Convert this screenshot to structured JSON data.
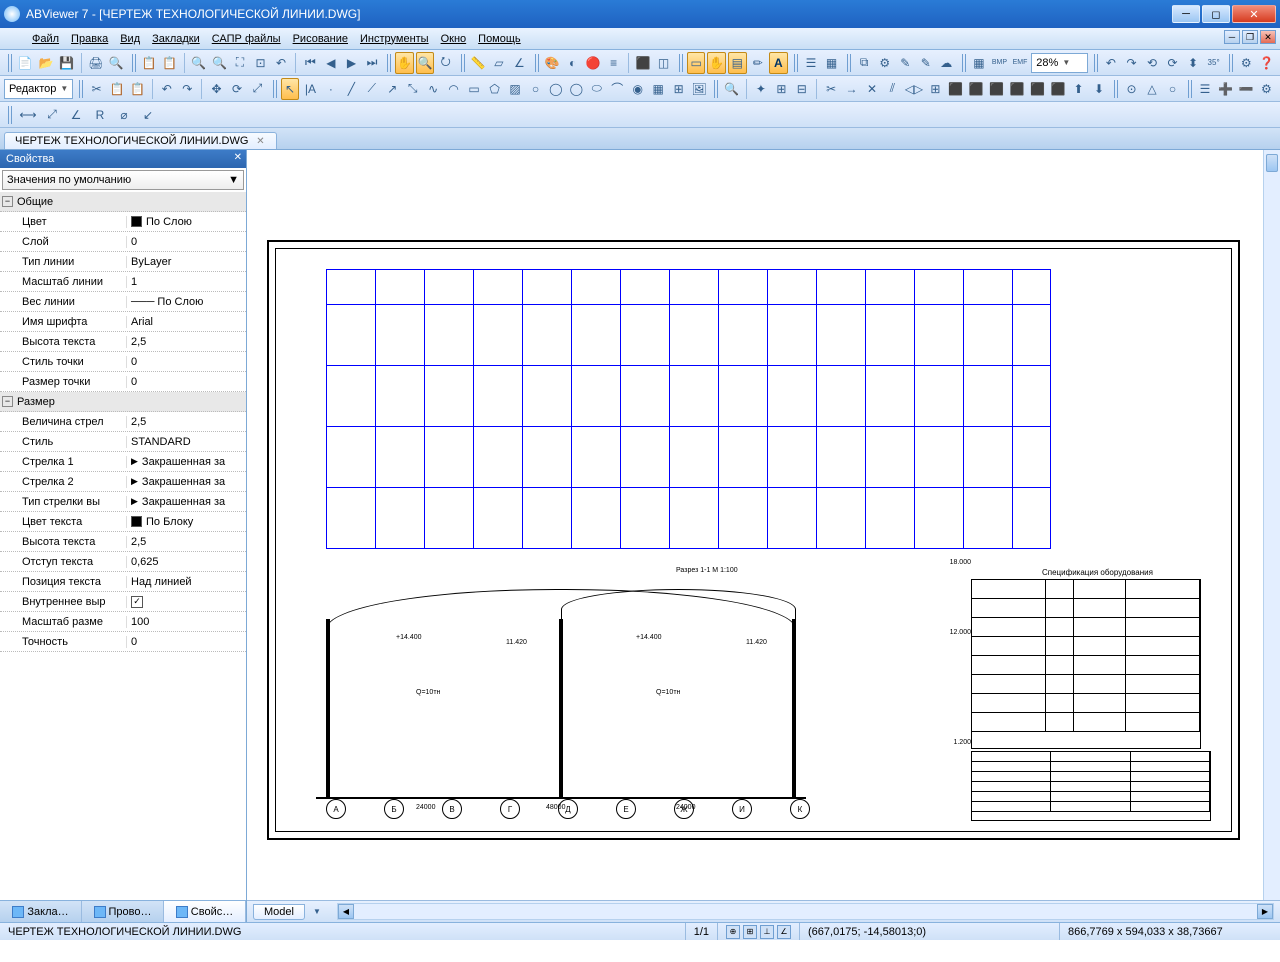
{
  "window": {
    "title": "ABViewer 7 - [ЧЕРТЕЖ ТЕХНОЛОГИЧЕСКОЙ ЛИНИИ.DWG]"
  },
  "menu": {
    "file": "Файл",
    "edit": "Правка",
    "view": "Вид",
    "bookmarks": "Закладки",
    "cad_files": "САПР файлы",
    "drawing": "Рисование",
    "tools": "Инструменты",
    "window": "Окно",
    "help": "Помощь"
  },
  "toolbar": {
    "mode_selector": "Редактор",
    "zoom_value": "28%"
  },
  "document_tab": {
    "name": "ЧЕРТЕЖ ТЕХНОЛОГИЧЕСКОЙ ЛИНИИ.DWG"
  },
  "properties_panel": {
    "title": "Свойства",
    "defaults_selector": "Значения по умолчанию",
    "categories": {
      "general": "Общие",
      "dimension": "Размер"
    },
    "rows": [
      {
        "k": "Цвет",
        "v": "По Слою",
        "swatch": true
      },
      {
        "k": "Слой",
        "v": "0"
      },
      {
        "k": "Тип линии",
        "v": "ByLayer"
      },
      {
        "k": "Масштаб линии",
        "v": "1"
      },
      {
        "k": "Вес линии",
        "v": "─── По Слою"
      },
      {
        "k": "Имя шрифта",
        "v": "Arial"
      },
      {
        "k": "Высота текста",
        "v": "2,5"
      },
      {
        "k": "Стиль точки",
        "v": "0"
      },
      {
        "k": "Размер точки",
        "v": "0"
      }
    ],
    "dim_rows": [
      {
        "k": "Величина стрел",
        "v": "2,5"
      },
      {
        "k": "Стиль",
        "v": "STANDARD"
      },
      {
        "k": "Стрелка 1",
        "v": "Закрашенная за",
        "arrow": true
      },
      {
        "k": "Стрелка 2",
        "v": "Закрашенная за",
        "arrow": true
      },
      {
        "k": "Тип стрелки вы",
        "v": "Закрашенная за",
        "arrow": true
      },
      {
        "k": "Цвет текста",
        "v": "По Блоку",
        "swatch": true
      },
      {
        "k": "Высота текста",
        "v": "2,5"
      },
      {
        "k": "Отступ текста",
        "v": "0,625"
      },
      {
        "k": "Позиция текста",
        "v": "Над линией"
      },
      {
        "k": "Внутреннее выр",
        "v": "",
        "check": true
      },
      {
        "k": "Масштаб разме",
        "v": "100"
      },
      {
        "k": "Точность",
        "v": "0"
      }
    ]
  },
  "bottom_tabs": {
    "bookmarks": "Закла…",
    "explorer": "Прово…",
    "properties": "Свойс…"
  },
  "canvas_tabs": {
    "model": "Model"
  },
  "drawing_labels": {
    "section_title": "Разрез 1-1 М 1:100",
    "spec_title": "Спецификация оборудования",
    "dim1": "+14.400",
    "dim2": "11.420",
    "load": "Q=10тн",
    "span1": "24000",
    "span2": "48000",
    "lvl1": "18.000",
    "lvl2": "12.000",
    "lvl3": "1.200",
    "axes": [
      "А",
      "Б",
      "В",
      "Г",
      "Д",
      "Е",
      "Ж",
      "И",
      "К"
    ]
  },
  "statusbar": {
    "file": "ЧЕРТЕЖ ТЕХНОЛОГИЧЕСКОЙ ЛИНИИ.DWG",
    "page": "1/1",
    "coords": "(667,0175; -14,58013;0)",
    "extents": "866,7769 x 594,033 x 38,73667"
  }
}
